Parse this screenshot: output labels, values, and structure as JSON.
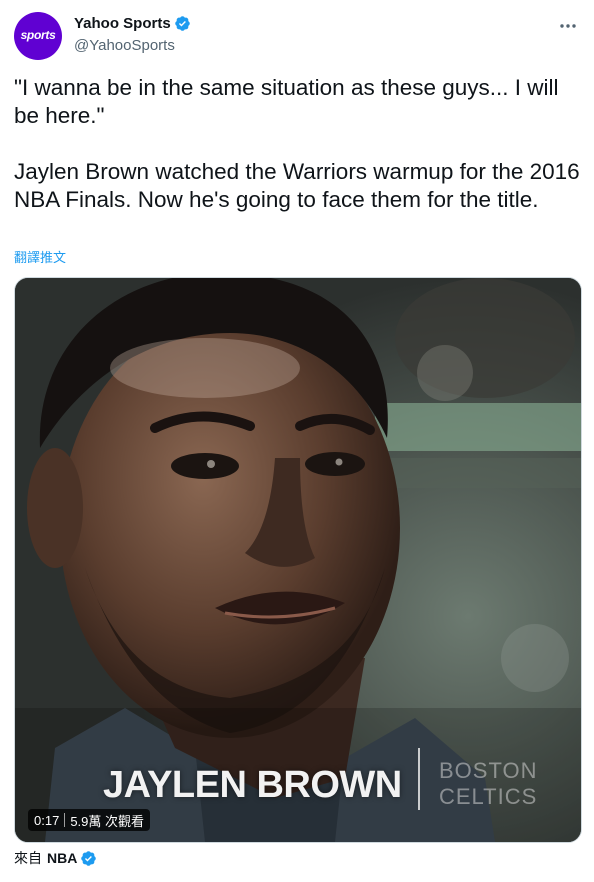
{
  "author": {
    "display_name": "Yahoo Sports",
    "handle": "@YahooSports",
    "avatar_text": "sports",
    "avatar_color": "#6001d2",
    "verified": true
  },
  "tweet": {
    "paragraphs": [
      "\"I wanna be in the same situation as these guys... I will be here.\"",
      "Jaylen Brown watched the Warriors warmup for the 2016 NBA Finals. Now he's going to face them for the title."
    ],
    "translate_label": "翻譯推文"
  },
  "media": {
    "caption_name": "JAYLEN BROWN",
    "caption_team": "BOSTON\nCELTICS",
    "duration": "0:17",
    "views": "5.9萬 次觀看"
  },
  "source": {
    "prefix": "來自",
    "name": "NBA",
    "verified": true
  },
  "colors": {
    "accent": "#1d9bf0",
    "text": "#0f1419",
    "secondary": "#536471"
  }
}
